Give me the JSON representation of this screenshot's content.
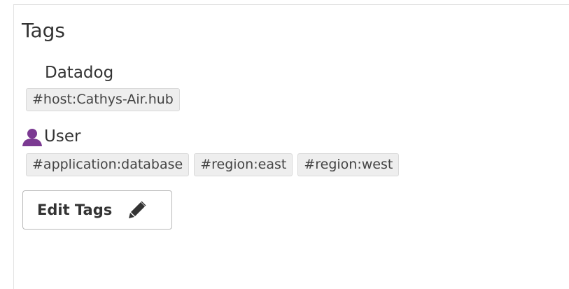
{
  "section": {
    "title": "Tags"
  },
  "sources": {
    "datadog": {
      "label": "Datadog",
      "tags": [
        "#host:Cathys-Air.hub"
      ]
    },
    "user": {
      "label": "User",
      "icon": "user-icon",
      "icon_color": "#7b3a92",
      "tags": [
        "#application:database",
        "#region:east",
        "#region:west"
      ]
    }
  },
  "actions": {
    "edit_label": "Edit Tags",
    "edit_icon": "pencil-icon"
  }
}
